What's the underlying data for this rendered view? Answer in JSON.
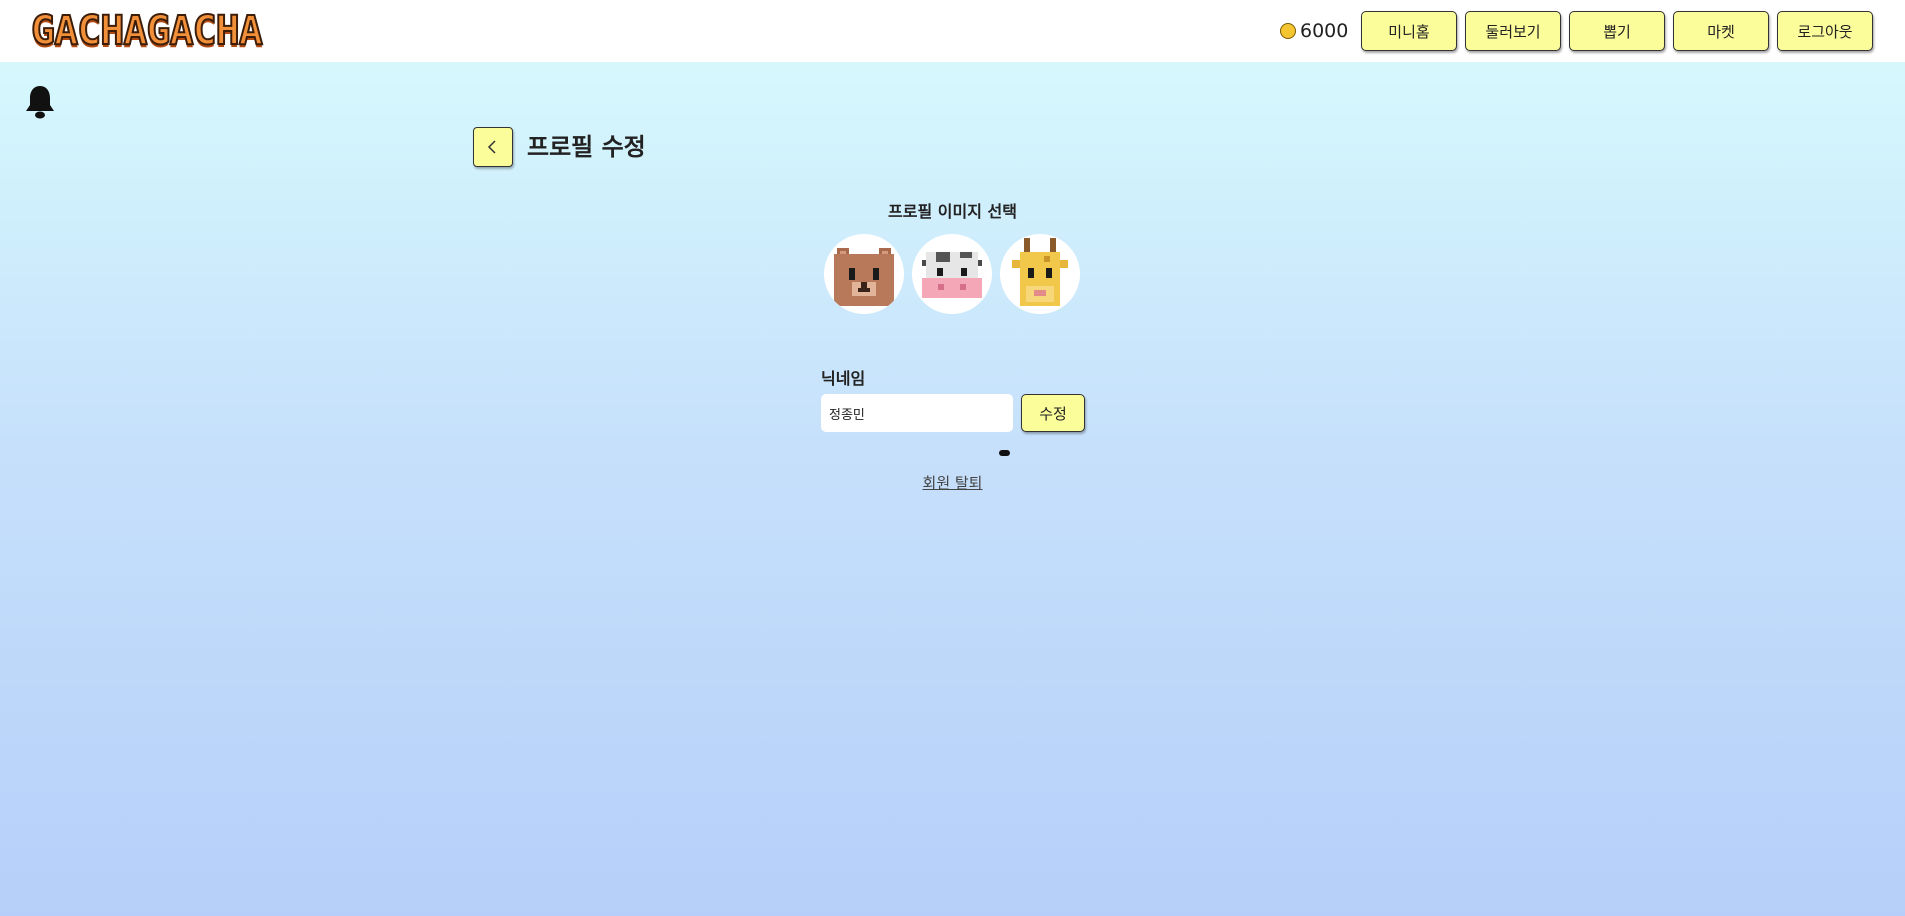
{
  "header": {
    "logo_text": "GACHAGACHA",
    "coin_amount": "6000",
    "nav": {
      "minihome": "미니홈",
      "browse": "둘러보기",
      "draw": "뽑기",
      "market": "마켓",
      "logout": "로그아웃"
    },
    "accent_color": "#fbfc9a"
  },
  "page": {
    "title": "프로필 수정",
    "profile_image_label": "프로필 이미지 선택",
    "avatars": [
      "bear-avatar",
      "cow-avatar",
      "giraffe-avatar"
    ],
    "nickname_label": "닉네임",
    "nickname_value": "정종민",
    "submit_label": "수정",
    "withdraw_label": "회원 탈퇴"
  },
  "icons": {
    "notification": "bell-icon",
    "back": "chevron-left-icon",
    "currency": "coin-icon"
  }
}
